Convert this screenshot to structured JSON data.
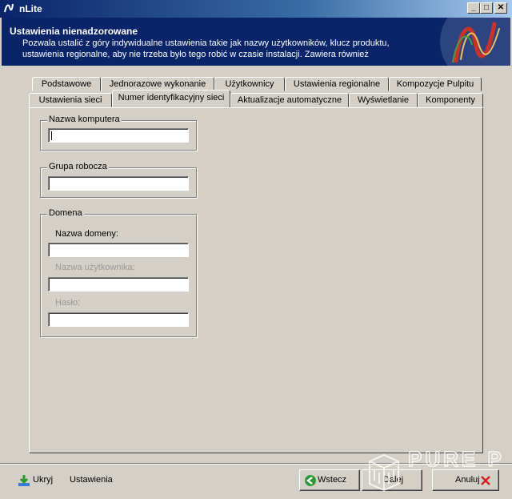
{
  "window": {
    "title": "nLite"
  },
  "titlebar_buttons": {
    "minimize": "_",
    "maximize": "□",
    "close": "✕"
  },
  "header": {
    "title": "Ustawienia nienadzorowane",
    "description": "Pozwala ustalić z góry indywidualne ustawienia takie jak nazwy użytkowników, klucz produktu, ustawienia regionalne, aby nie trzeba było tego robić w czasie instalacji. Zawiera również"
  },
  "tabs_row1": [
    "Podstawowe",
    "Jednorazowe wykonanie",
    "Użytkownicy",
    "Ustawienia regionalne",
    "Kompozycje Pulpitu"
  ],
  "tabs_row2": [
    "Ustawienia sieci",
    "Numer identyfikacyjny sieci",
    "Aktualizacje automatyczne",
    "Wyświetlanie",
    "Komponenty"
  ],
  "active_tab": "Numer identyfikacyjny sieci",
  "groups": {
    "computer_name": {
      "legend": "Nazwa komputera",
      "value": ""
    },
    "workgroup": {
      "legend": "Grupa robocza",
      "value": ""
    },
    "domain": {
      "legend": "Domena",
      "domain_name_label": "Nazwa domeny:",
      "domain_name_value": "",
      "username_label": "Nazwa użytkownika:",
      "username_value": "",
      "password_label": "Hasło:",
      "password_value": ""
    }
  },
  "bottom": {
    "hide_label": "Ukryj",
    "settings_label": "Ustawienia",
    "back_label": "Wstecz",
    "next_label": "Dalej",
    "cancel_label": "Anuluj"
  },
  "watermark": {
    "text": "PURE PC"
  },
  "colors": {
    "header_bg": "#0a246a",
    "face": "#d4d0c8",
    "title_grad_end": "#a6caf0"
  },
  "icons": {
    "app": "nlite-logo-icon",
    "hide": "download-arrow-icon",
    "back": "back-arrow-icon",
    "cancel": "close-x-icon"
  }
}
